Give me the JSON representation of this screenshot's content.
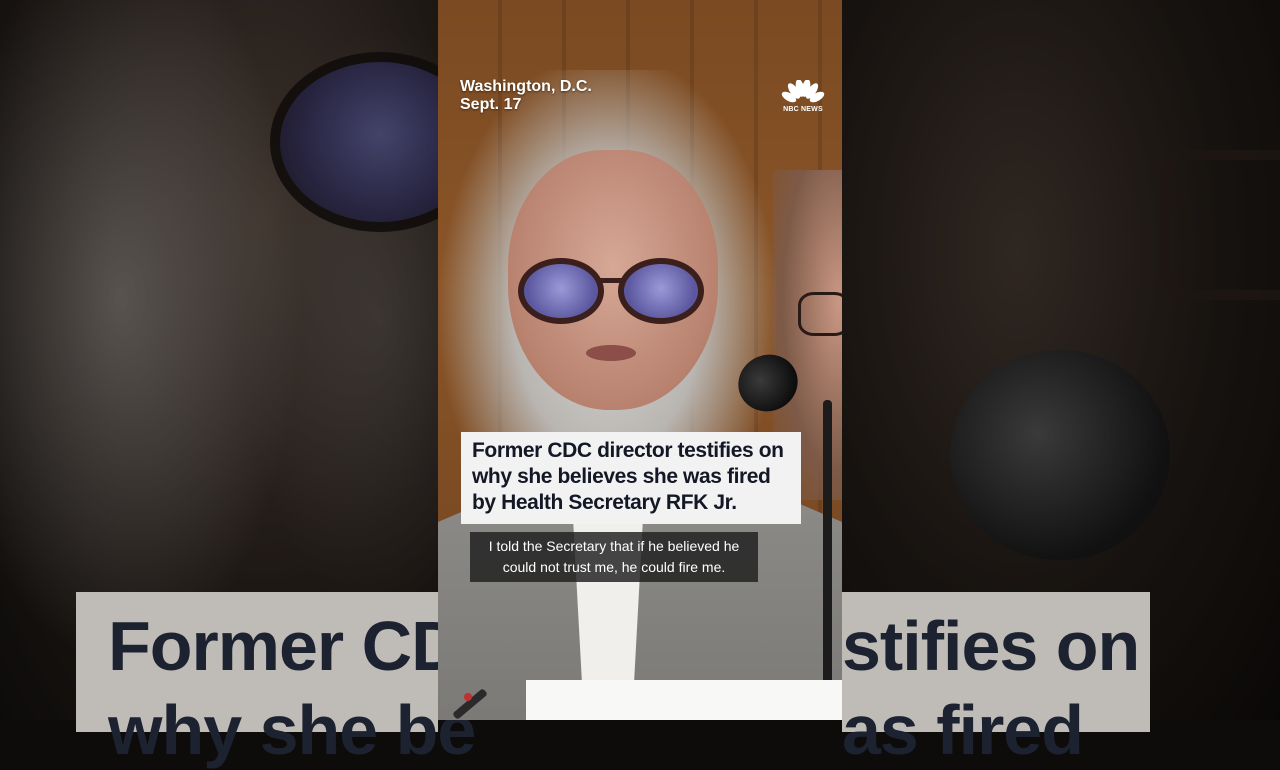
{
  "video": {
    "location_line1": "Washington, D.C.",
    "location_line2": "Sept. 17",
    "network_logo_text": "NBC NEWS",
    "headline": "Former CDC director testifies on why she believes she was fired by Health Secretary RFK Jr.",
    "caption": "I told the Secretary that if he believed he could not trust me, he could fire me."
  },
  "background": {
    "left_banner_line1": "Former CD",
    "left_banner_line2": "why she be",
    "right_banner_line1": "stifies on",
    "right_banner_line2": "as fired"
  },
  "colors": {
    "headline_bg": "#f2f2f2",
    "headline_text": "#141826",
    "caption_bg": "#1e1e1e"
  }
}
